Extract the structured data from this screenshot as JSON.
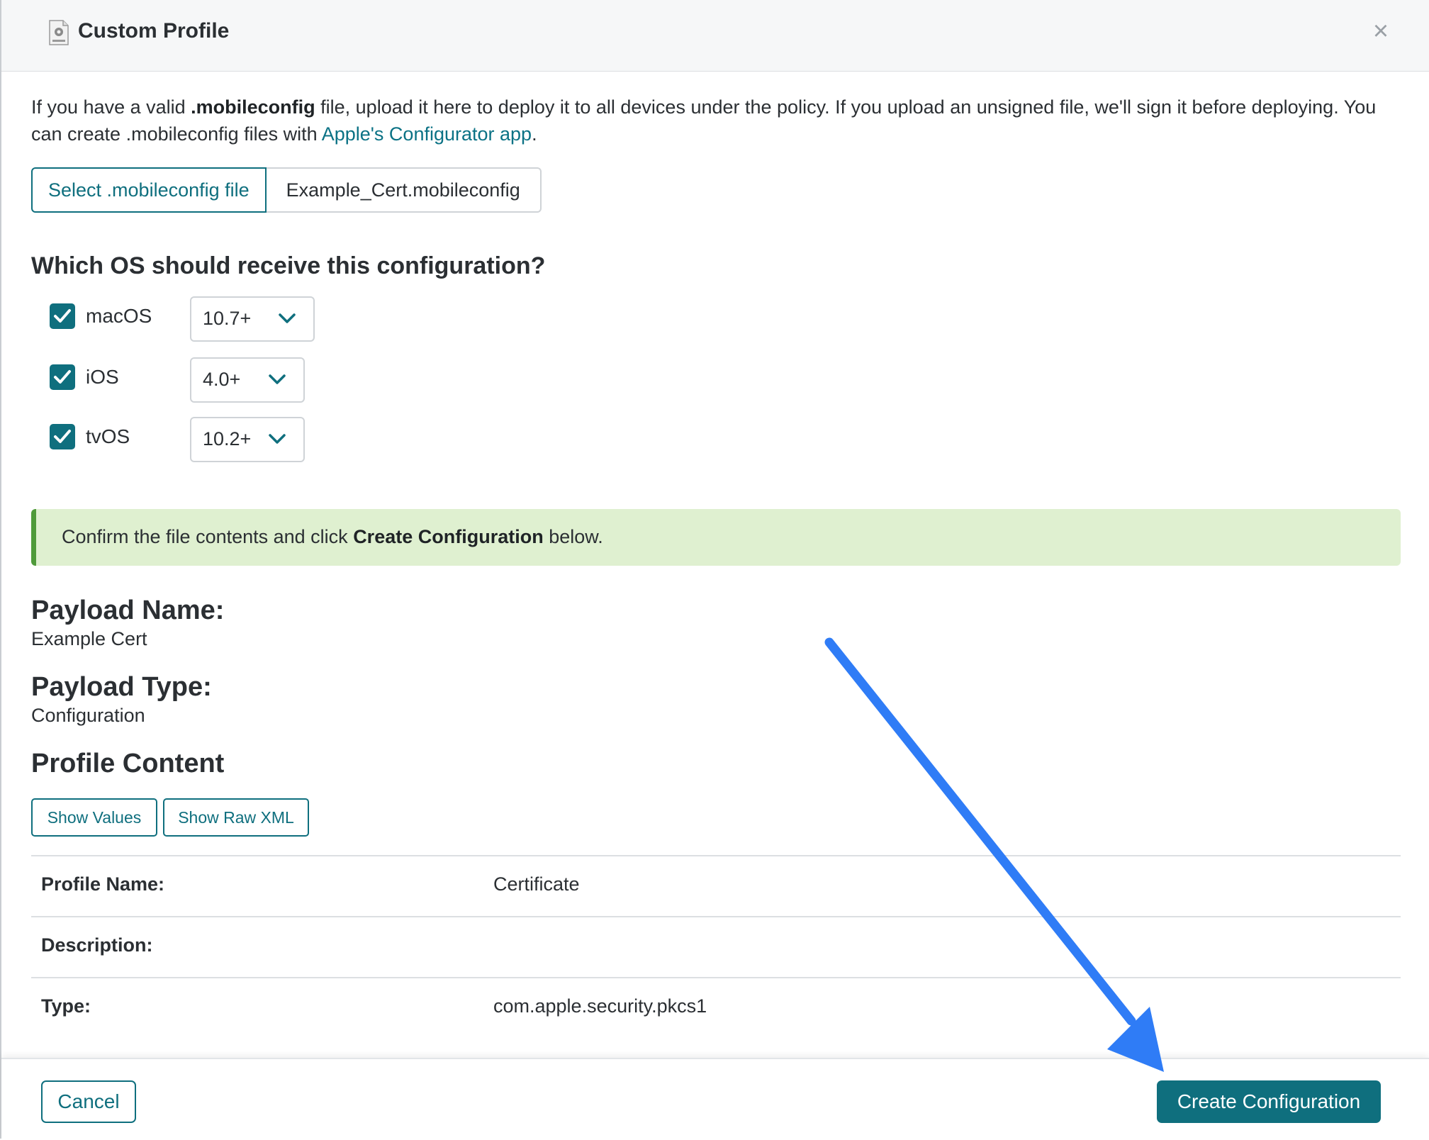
{
  "header": {
    "title": "Custom Profile",
    "icon": "config-file-icon",
    "close_icon": "close-icon"
  },
  "intro": {
    "part1": "If you have a valid ",
    "bold": ".mobileconfig",
    "part2": " file, upload it here to deploy it to all devices under the policy. If you upload an unsigned file, we'll sign it before deploying. You can create .mobileconfig files with ",
    "link": "Apple's Configurator app",
    "part3": "."
  },
  "file_picker": {
    "button_label": "Select .mobileconfig file",
    "file_name": "Example_Cert.mobileconfig"
  },
  "os_section": {
    "heading": "Which OS should receive this configuration?",
    "items": [
      {
        "label": "macOS",
        "checked": true,
        "version": "10.7+"
      },
      {
        "label": "iOS",
        "checked": true,
        "version": "4.0+"
      },
      {
        "label": "tvOS",
        "checked": true,
        "version": "10.2+"
      }
    ]
  },
  "alert": {
    "part1": "Confirm the file contents and click ",
    "bold": "Create Configuration",
    "part2": " below."
  },
  "payload": {
    "name_title": "Payload Name:",
    "name_value": "Example Cert",
    "type_title": "Payload Type:",
    "type_value": "Configuration"
  },
  "profile_content": {
    "title": "Profile Content",
    "show_values_label": "Show Values",
    "show_raw_xml_label": "Show Raw XML",
    "rows": [
      {
        "key": "Profile Name:",
        "value": "Certificate"
      },
      {
        "key": "Description:",
        "value": ""
      },
      {
        "key": "Type:",
        "value": "com.apple.security.pkcs1"
      }
    ]
  },
  "footer": {
    "cancel_label": "Cancel",
    "create_label": "Create Configuration"
  },
  "colors": {
    "accent": "#0f6f7e",
    "link": "#0b7285",
    "alert_bg": "#dff0d0",
    "alert_border": "#4f9a3a",
    "annotation_arrow": "#2f7cf6"
  }
}
